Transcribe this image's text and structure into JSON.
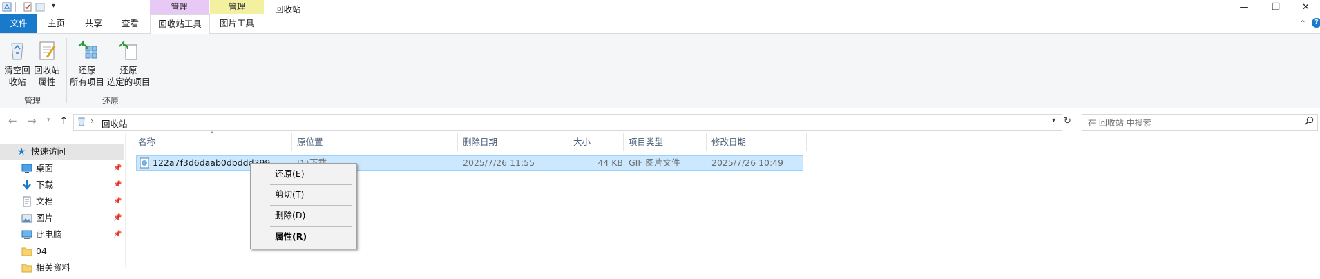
{
  "window": {
    "title": "回收站",
    "minimize_glyph": "—",
    "restore_glyph": "❐",
    "close_glyph": "✕"
  },
  "ribbon": {
    "context_headers": [
      "管理",
      "管理"
    ],
    "tabs": {
      "file": "文件",
      "home": "主页",
      "share": "共享",
      "view": "查看",
      "recycle_tools": "回收站工具",
      "picture_tools": "图片工具"
    },
    "buttons": {
      "empty_line1": "清空回",
      "empty_line2": "收站",
      "props_line1": "回收站",
      "props_line2": "属性",
      "restore_all_line1": "还原",
      "restore_all_line2": "所有项目",
      "restore_sel_line1": "还原",
      "restore_sel_line2": "选定的项目"
    },
    "groups": {
      "manage": "管理",
      "restore": "还原"
    },
    "colors": {
      "file_tab": "#1979ca",
      "manage_ctx1": "#e8c8f4",
      "manage_ctx2": "#f3f0a0"
    }
  },
  "address": {
    "path_root": "回收站",
    "search_placeholder": "在 回收站 中搜索",
    "separator": "›"
  },
  "nav_pane": {
    "items": [
      {
        "label": "快速访问",
        "pinned": false
      },
      {
        "label": "桌面",
        "pinned": true
      },
      {
        "label": "下载",
        "pinned": true
      },
      {
        "label": "文档",
        "pinned": true
      },
      {
        "label": "图片",
        "pinned": true
      },
      {
        "label": "此电脑",
        "pinned": true
      },
      {
        "label": "04",
        "pinned": false
      },
      {
        "label": "相关资料",
        "pinned": false
      }
    ]
  },
  "columns": {
    "name": "名称",
    "original_location": "原位置",
    "date_deleted": "删除日期",
    "size": "大小",
    "type": "项目类型",
    "date_modified": "修改日期"
  },
  "files": [
    {
      "name": "122a7f3d6daab0dbddd399f..4",
      "original_location": "D:\\下载",
      "date_deleted": "2025/7/26 11:55",
      "size": "44 KB",
      "type": "GIF 图片文件",
      "date_modified": "2025/7/26 10:49"
    }
  ],
  "context_menu": {
    "items": [
      "还原(E)",
      "剪切(T)",
      "删除(D)",
      "属性(R)"
    ]
  }
}
